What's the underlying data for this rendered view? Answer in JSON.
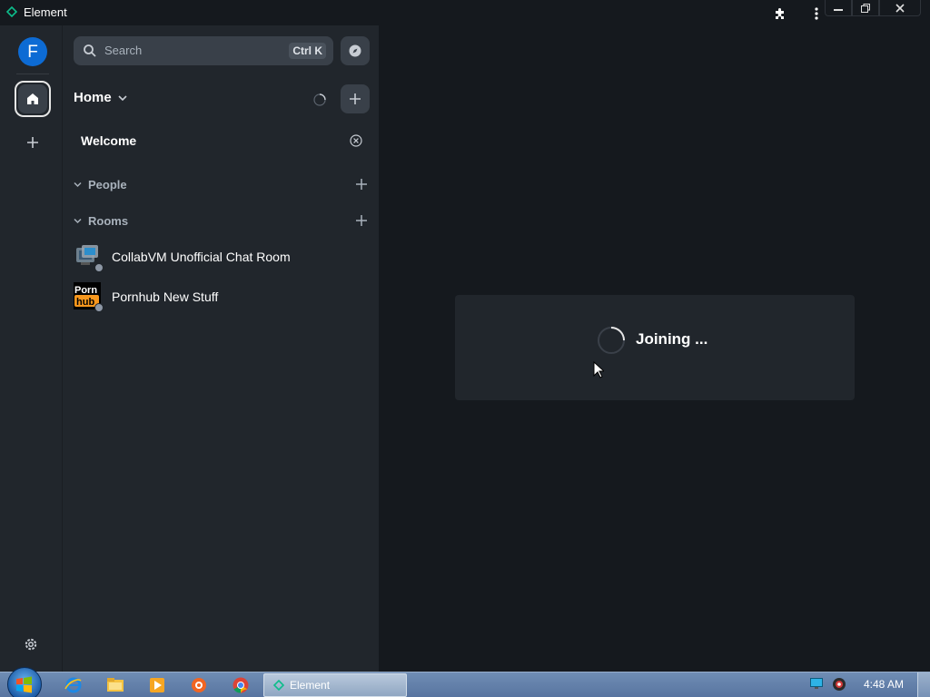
{
  "window": {
    "title": "Element",
    "icons": [
      "element-logo-icon",
      "extensions-icon",
      "kebab-menu-icon",
      "minimize-icon",
      "restore-icon",
      "close-icon"
    ]
  },
  "space_panel": {
    "avatar_letter": "F",
    "items": [
      {
        "name": "home",
        "icon": "home-icon",
        "selected": true
      },
      {
        "name": "create-space",
        "icon": "plus-icon"
      }
    ],
    "settings_icon": "gear-icon"
  },
  "room_list": {
    "search": {
      "placeholder": "Search",
      "shortcut": "Ctrl K"
    },
    "header": {
      "title": "Home"
    },
    "welcome": {
      "label": "Welcome"
    },
    "sections": [
      {
        "label": "People"
      },
      {
        "label": "Rooms"
      }
    ],
    "rooms": [
      {
        "name": "CollabVM Unofficial Chat Room",
        "avatar": "collabvm-avatar"
      },
      {
        "name": "Pornhub New Stuff",
        "avatar": "pornhub-avatar",
        "avatar_text_top": "Porn",
        "avatar_text_bottom": "hub"
      }
    ]
  },
  "main": {
    "status_text": "Joining ..."
  },
  "taskbar": {
    "task_label": "Element",
    "clock": "4:48 AM",
    "pinned": [
      "internet-explorer-icon",
      "file-explorer-icon",
      "media-player-icon",
      "app-icon",
      "chrome-icon"
    ]
  },
  "colors": {
    "background": "#15191e",
    "panel": "#21262c",
    "accent": "#0dbd8b",
    "avatar": "#0d6bd4"
  }
}
